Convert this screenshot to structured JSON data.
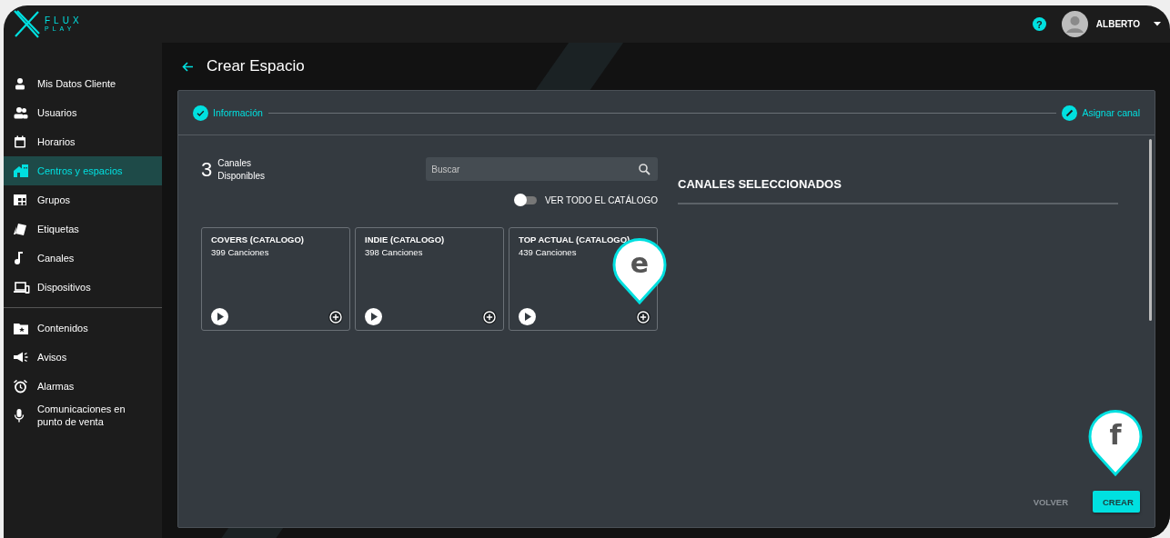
{
  "logo": {
    "name": "FLUX",
    "sub": "PLAY"
  },
  "header": {
    "help": "?",
    "user": "ALBERTO"
  },
  "sidebar": {
    "sections": [
      [
        {
          "label": "Mis Datos Cliente",
          "selected": false
        },
        {
          "label": "Usuarios",
          "selected": false
        },
        {
          "label": "Horarios",
          "selected": false
        },
        {
          "label": "Centros y espacios",
          "selected": true
        },
        {
          "label": "Grupos",
          "selected": false
        },
        {
          "label": "Etiquetas",
          "selected": false
        },
        {
          "label": "Canales",
          "selected": false
        },
        {
          "label": "Dispositivos",
          "selected": false
        }
      ],
      [
        {
          "label": "Contenidos",
          "selected": false
        },
        {
          "label": "Avisos",
          "selected": false
        },
        {
          "label": "Alarmas",
          "selected": false
        },
        {
          "label": "Comunicaciones en punto de venta",
          "selected": false
        }
      ]
    ]
  },
  "page": {
    "title": "Crear Espacio"
  },
  "stepper": [
    {
      "label": "Información",
      "completed": true
    },
    {
      "label": "Asignar canal",
      "completed": false
    }
  ],
  "available": {
    "count": "3",
    "label": "Canales Disponibles"
  },
  "search": {
    "placeholder": "Buscar"
  },
  "catalog_toggle": {
    "label": "VER TODO EL CATÁLOGO",
    "on": false
  },
  "channels": [
    {
      "title": "COVERS (CATALOGO)",
      "songs": "399 Canciones"
    },
    {
      "title": "INDIE (CATALOGO)",
      "songs": "398 Canciones"
    },
    {
      "title": "TOP ACTUAL (CATALOGO)",
      "songs": "439 Canciones"
    }
  ],
  "selected_panel": {
    "title": "CANALES SELECCIONADOS"
  },
  "buttons": [
    {
      "label": "VOLVER",
      "kind": "text"
    },
    {
      "label": "CREAR",
      "kind": "primary"
    }
  ],
  "callouts": [
    {
      "label": "e"
    },
    {
      "label": "f"
    }
  ]
}
